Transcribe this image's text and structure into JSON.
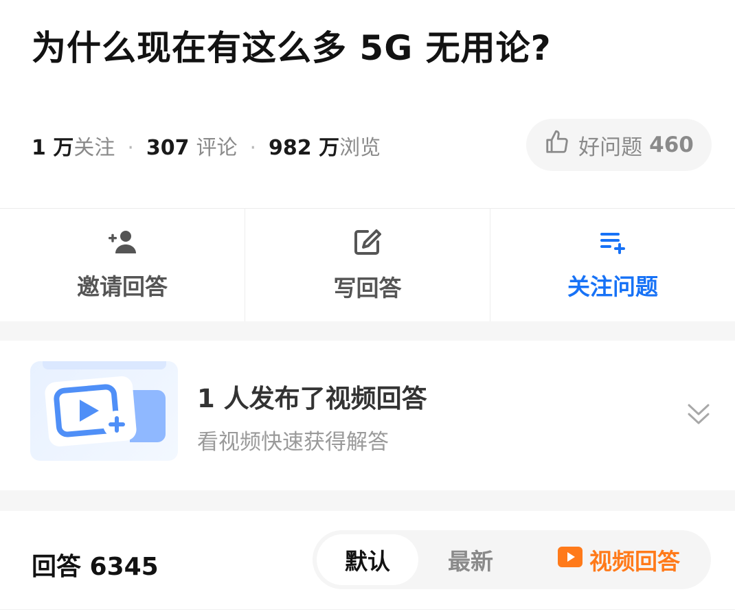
{
  "question": {
    "title": "为什么现在有这么多 5G 无用论?"
  },
  "stats": {
    "follow_num": "1 万",
    "follow_label": "关注",
    "comment_num": "307",
    "comment_label": "评论",
    "view_num": "982 万",
    "view_label": "浏览",
    "separator": "·"
  },
  "good_question": {
    "icon": "thumbs-up-icon",
    "label": "好问题",
    "count": "460"
  },
  "actions": [
    {
      "label": "邀请回答",
      "icon": "add-user-icon"
    },
    {
      "label": "写回答",
      "icon": "edit-icon"
    },
    {
      "label": "关注问题",
      "icon": "add-to-list-icon",
      "color": "#1772f6"
    }
  ],
  "video_answer": {
    "title": "1 人发布了视频回答",
    "subtitle": "看视频快速获得解答",
    "icon": "video-add-icon",
    "expand_icon": "chevron-double-down-icon"
  },
  "answers": {
    "label": "回答 6345",
    "tabs": {
      "default": "默认",
      "newest": "最新",
      "video": "视频回答"
    },
    "video_tab_color": "#ff7a1a"
  }
}
